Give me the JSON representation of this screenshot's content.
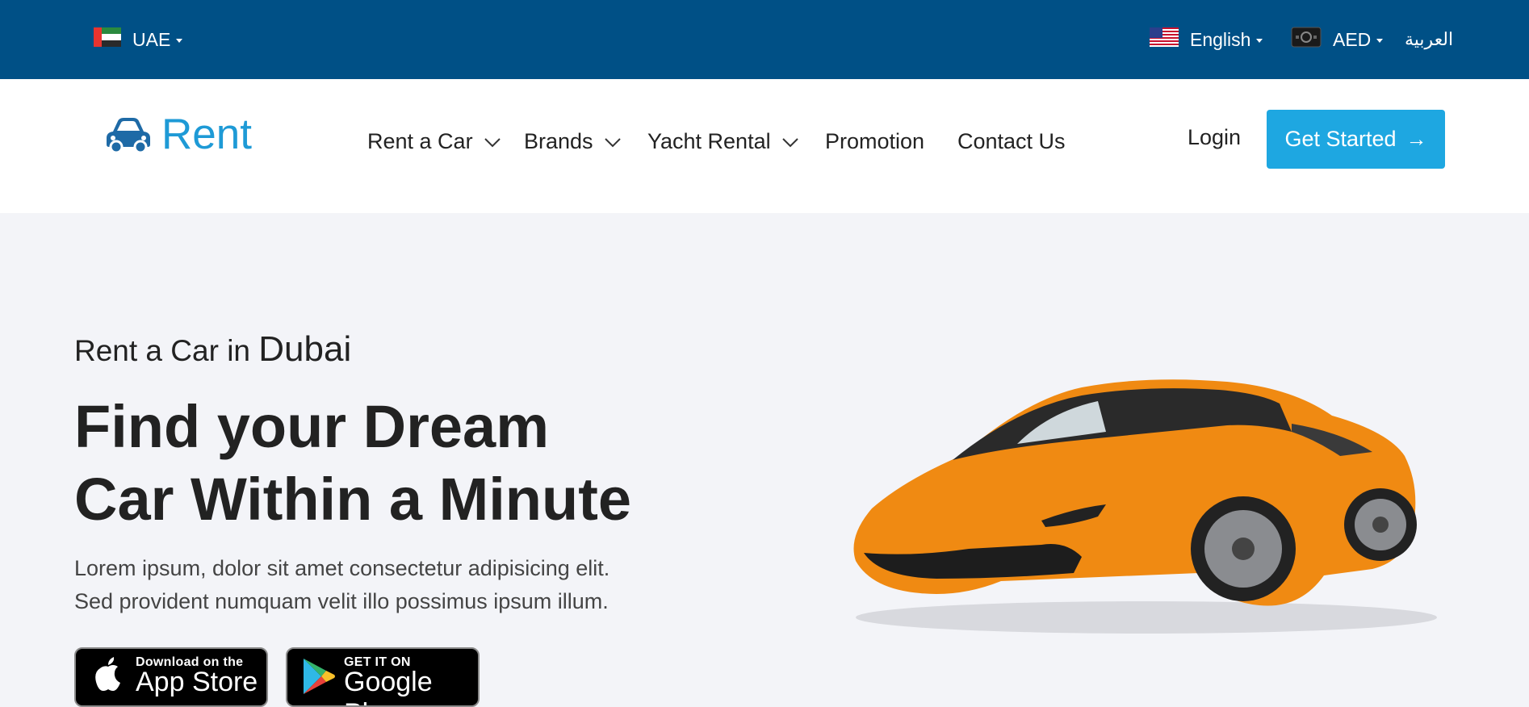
{
  "topbar": {
    "country_label": "UAE",
    "language_label": "English",
    "currency_label": "AED",
    "arabic_link": "العربية"
  },
  "header": {
    "logo_text": "Rent",
    "menu": [
      {
        "label": "Rent a Car",
        "has_dropdown": true
      },
      {
        "label": "Brands",
        "has_dropdown": true
      },
      {
        "label": "Yacht Rental",
        "has_dropdown": true
      },
      {
        "label": "Promotion",
        "has_dropdown": false
      },
      {
        "label": "Contact Us",
        "has_dropdown": false
      }
    ],
    "login_label": "Login",
    "cta_label": "Get Started",
    "cta_arrow": "→"
  },
  "hero": {
    "subtitle_prefix": "Rent a Car in ",
    "subtitle_city": "Dubai",
    "title_line1": "Find your Dream",
    "title_line2": "Car Within a Minute",
    "desc_line1": "Lorem ipsum, dolor sit amet consectetur adipisicing elit.",
    "desc_line2": "Sed provident numquam velit illo possimus ipsum illum."
  },
  "stores": {
    "apple_small": "Download on the",
    "apple_big": "App Store",
    "google_small": "GET IT ON",
    "google_big": "Google Play"
  },
  "icons": {
    "uae_flag": "uae-flag-icon",
    "us_flag": "us-flag-icon",
    "currency": "cash-icon",
    "logo": "car-icon",
    "apple": "apple-icon",
    "google_play": "google-play-icon"
  },
  "colors": {
    "topbar_bg": "#005086",
    "brand": "#1e9ad6",
    "cta_bg": "#1ea7e1",
    "hero_bg": "#f3f4f8",
    "car_body": "#f08a12"
  }
}
